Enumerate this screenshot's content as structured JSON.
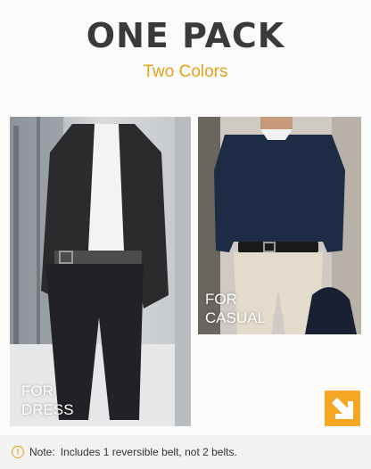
{
  "header": {
    "title": "ONE PACK",
    "subtitle": "Two Colors"
  },
  "photos": {
    "dress": {
      "caption_line1": "FOR",
      "caption_line2": "DRESS"
    },
    "casual": {
      "caption_line1": "FOR",
      "caption_line2": "CASUAL"
    }
  },
  "note": {
    "label": "Note:",
    "text": "Includes 1 reversible belt, not 2 belts."
  },
  "colors": {
    "accent": "#e3a21a",
    "title": "#3a3a3a",
    "arrow_badge": "#f5a623"
  },
  "icons": {
    "info": "info-circle-icon",
    "arrow": "arrow-down-right-icon"
  }
}
